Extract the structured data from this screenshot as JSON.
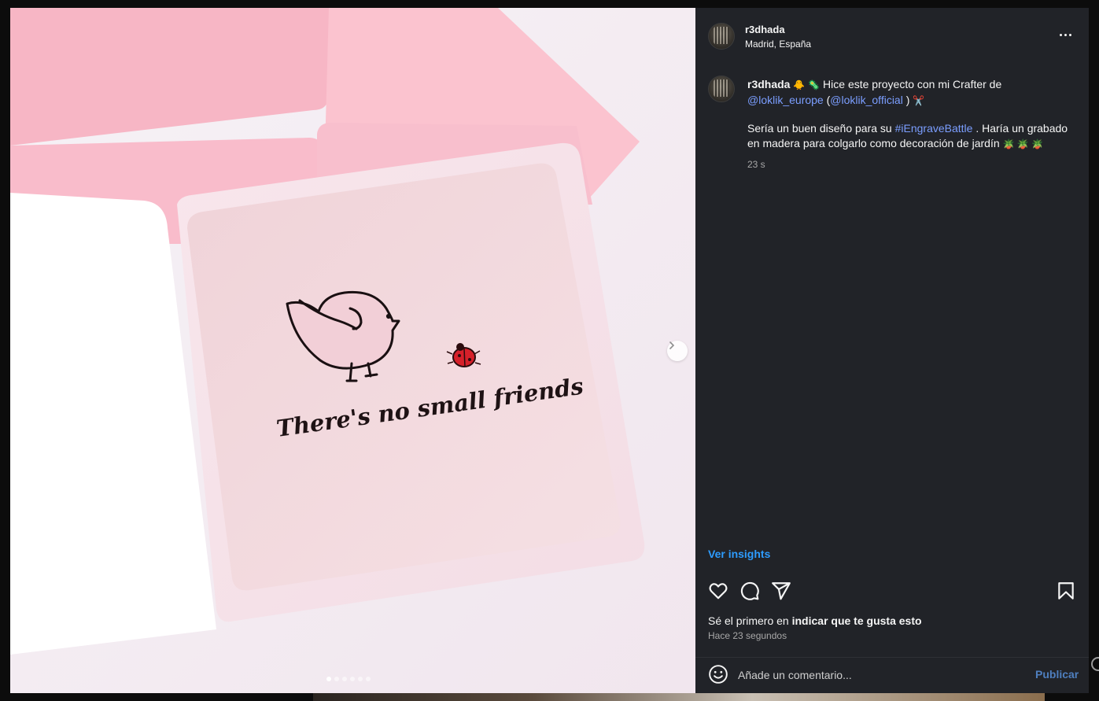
{
  "post": {
    "username": "r3dhada",
    "location": "Madrid, España",
    "caption": {
      "line1_pre": "Hice este proyecto con mi Crafter de",
      "mention1": "@loklik_europe",
      "paren_open": "(",
      "mention2": "@loklik_official",
      "paren_close": ")",
      "para2_pre": "Sería un buen diseño para su",
      "hashtag": "#iEngraveBattle",
      "para2_post": ". Haría un grabado en madera para colgarlo como decoración de jardín",
      "emoji_chick": "🐥",
      "emoji_virus": "🦠",
      "emoji_scissors": "✂️",
      "emoji_plants": "🪴 🪴 🪴"
    },
    "time_short": "23 s",
    "insights_label": "Ver insights",
    "likes_prefix": "Sé el primero en",
    "likes_link": "indicar que te gusta esto",
    "time_ago": "Hace 23 segundos",
    "comment_placeholder": "Añade un comentario...",
    "publish_label": "Publicar"
  },
  "media": {
    "card_text": "There's no small friends",
    "carousel_count": 6,
    "carousel_active": 1
  },
  "icons": {
    "more": "more-options-icon",
    "like": "heart-icon",
    "comment": "comment-icon",
    "share": "share-icon",
    "save": "bookmark-icon",
    "emoji": "emoji-icon",
    "next": "chevron-right-icon"
  },
  "colors": {
    "panel_bg": "#212328",
    "link": "#7b9eff",
    "insights": "#2d9cff",
    "publish": "#4f7fbf",
    "envelope_pink": "#f7b9c7",
    "card_pink": "#f2d6dc"
  }
}
